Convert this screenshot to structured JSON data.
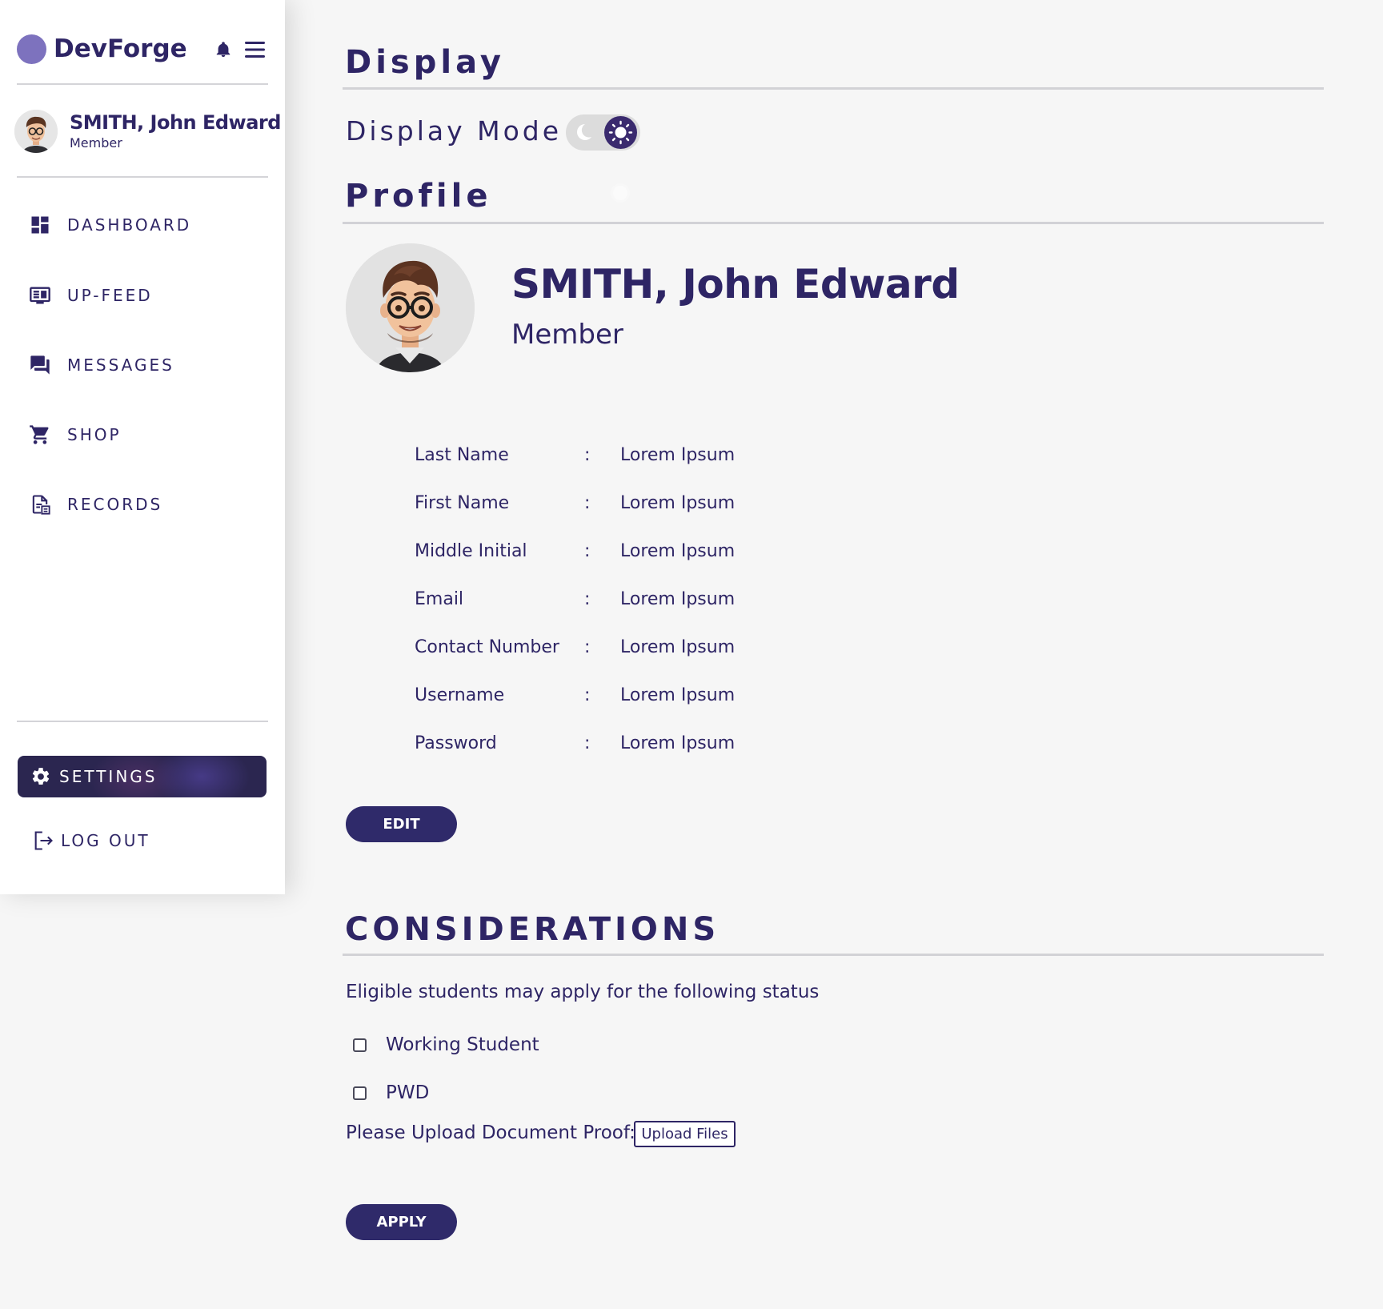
{
  "brand": {
    "name": "DevForge",
    "dot_color": "#7d72be"
  },
  "header_icons": {
    "notifications": "bell-icon",
    "menu": "hamburger-menu-icon"
  },
  "user": {
    "name": "SMITH, John Edward",
    "role": "Member"
  },
  "sidebar": {
    "items": [
      {
        "label": "DASHBOARD",
        "icon": "dashboard-icon"
      },
      {
        "label": "UP-FEED",
        "icon": "feed-icon"
      },
      {
        "label": "MESSAGES",
        "icon": "messages-icon"
      },
      {
        "label": "SHOP",
        "icon": "cart-icon"
      },
      {
        "label": "RECORDS",
        "icon": "records-icon"
      }
    ],
    "settings": {
      "label": "SETTINGS",
      "icon": "gear-icon",
      "active": true
    },
    "logout": {
      "label": "LOG OUT",
      "icon": "logout-icon"
    }
  },
  "display": {
    "title": "Display",
    "mode_label": "Display Mode",
    "mode": "light"
  },
  "profile": {
    "title": "Profile",
    "name": "SMITH, John Edward",
    "role": "Member",
    "fields": [
      {
        "label": "Last Name",
        "value": "Lorem Ipsum"
      },
      {
        "label": "First Name",
        "value": "Lorem Ipsum"
      },
      {
        "label": "Middle Initial",
        "value": "Lorem Ipsum"
      },
      {
        "label": "Email",
        "value": "Lorem Ipsum"
      },
      {
        "label": "Contact Number",
        "value": "Lorem Ipsum"
      },
      {
        "label": "Username",
        "value": "Lorem Ipsum"
      },
      {
        "label": "Password",
        "value": "Lorem Ipsum"
      }
    ],
    "separator": ":",
    "edit_label": "EDIT"
  },
  "considerations": {
    "title": "CONSIDERATIONS",
    "intro": "Eligible students may apply for the following status",
    "options": [
      {
        "label": "Working Student",
        "checked": false
      },
      {
        "label": "PWD",
        "checked": false
      }
    ],
    "upload_label": "Please Upload Document Proof:",
    "upload_button": "Upload Files",
    "apply_label": "APPLY"
  },
  "colors": {
    "primary": "#2e2565",
    "button": "#2f2a6a",
    "background": "#f6f6f6",
    "sidebar_bg": "#ffffff",
    "brand_accent": "#7d72be"
  }
}
